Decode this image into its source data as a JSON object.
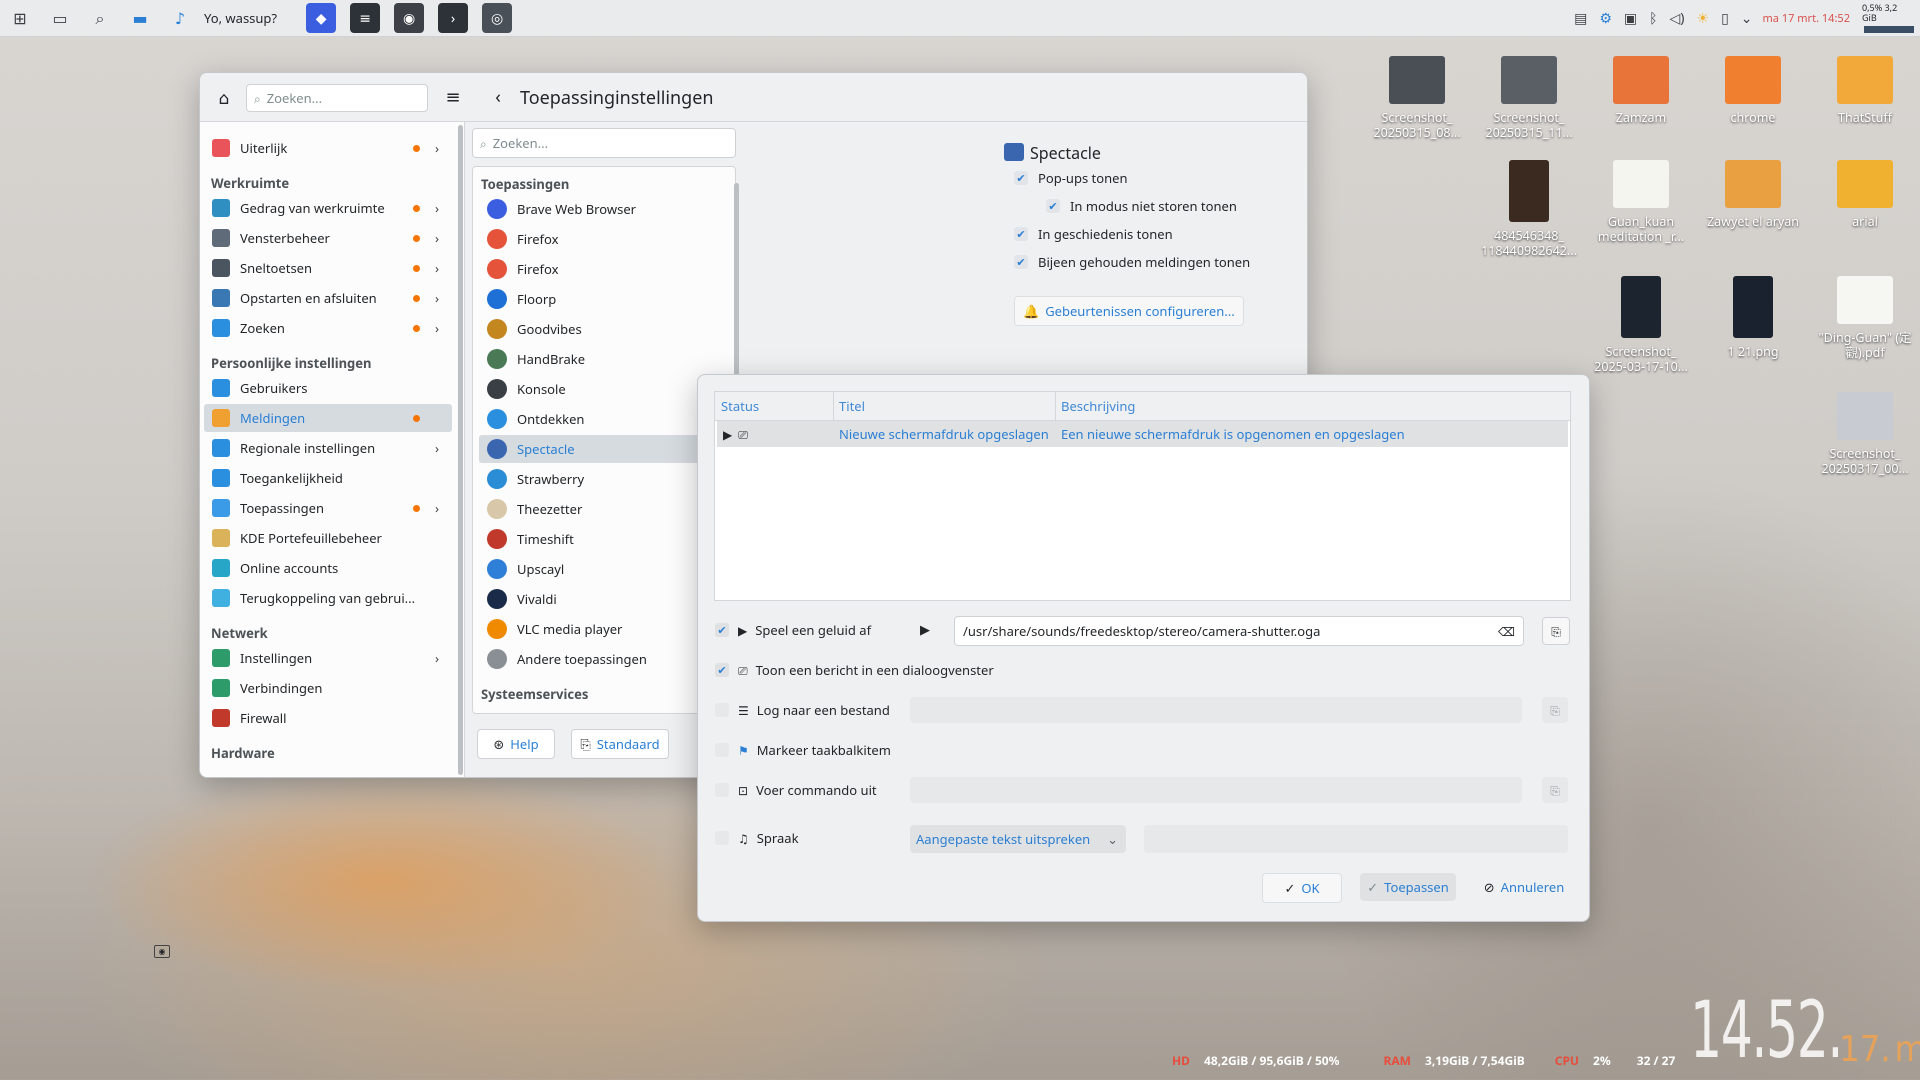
{
  "taskbar": {
    "window_title": "Yo, wassup?",
    "clock": "ma 17 mrt. 14:52",
    "cpu_mini": "0,5%",
    "mem_mini": "3,2 GiB"
  },
  "settings": {
    "search_placeholder": "Zoeken...",
    "page_title": "Toepassinginstellingen",
    "sidebar": [
      {
        "type": "item",
        "label": "Uiterlijk",
        "dot": true,
        "chev": true,
        "color": "#e9535a"
      },
      {
        "type": "section",
        "label": "Werkruimte"
      },
      {
        "type": "item",
        "label": "Gedrag van werkruimte",
        "dot": true,
        "chev": true,
        "color": "#2f8fc1"
      },
      {
        "type": "item",
        "label": "Vensterbeheer",
        "dot": true,
        "chev": true,
        "color": "#5f6b78"
      },
      {
        "type": "item",
        "label": "Sneltoetsen",
        "dot": true,
        "chev": true,
        "color": "#4a5560"
      },
      {
        "type": "item",
        "label": "Opstarten en afsluiten",
        "dot": true,
        "chev": true,
        "color": "#3a78b4"
      },
      {
        "type": "item",
        "label": "Zoeken",
        "dot": true,
        "chev": true,
        "color": "#2b8fe0"
      },
      {
        "type": "section",
        "label": "Persoonlijke instellingen"
      },
      {
        "type": "item",
        "label": "Gebruikers",
        "dot": false,
        "chev": false,
        "color": "#2b8fe0"
      },
      {
        "type": "item",
        "label": "Meldingen",
        "dot": true,
        "chev": false,
        "color": "#f0a030",
        "selected": true
      },
      {
        "type": "item",
        "label": "Regionale instellingen",
        "dot": false,
        "chev": true,
        "color": "#2b8fe0"
      },
      {
        "type": "item",
        "label": "Toegankelijkheid",
        "dot": false,
        "chev": false,
        "color": "#2b8fe0"
      },
      {
        "type": "item",
        "label": "Toepassingen",
        "dot": true,
        "chev": true,
        "color": "#3b9be6"
      },
      {
        "type": "item",
        "label": "KDE Portefeuillebeheer",
        "dot": false,
        "chev": false,
        "color": "#d9b25a"
      },
      {
        "type": "item",
        "label": "Online accounts",
        "dot": false,
        "chev": false,
        "color": "#27a6c8"
      },
      {
        "type": "item",
        "label": "Terugkoppeling van gebrui...",
        "dot": false,
        "chev": false,
        "color": "#3fb0e0"
      },
      {
        "type": "section",
        "label": "Netwerk"
      },
      {
        "type": "item",
        "label": "Instellingen",
        "dot": false,
        "chev": true,
        "color": "#2e9b6a"
      },
      {
        "type": "item",
        "label": "Verbindingen",
        "dot": false,
        "chev": false,
        "color": "#2e9b6a"
      },
      {
        "type": "item",
        "label": "Firewall",
        "dot": false,
        "chev": false,
        "color": "#c0392b"
      },
      {
        "type": "section",
        "label": "Hardware"
      }
    ],
    "apps_search_placeholder": "Zoeken...",
    "apps_section": "Toepassingen",
    "apps": [
      {
        "label": "Brave Web Browser",
        "color": "#3b5ee0"
      },
      {
        "label": "Firefox",
        "color": "#e5533a"
      },
      {
        "label": "Firefox",
        "color": "#e5533a"
      },
      {
        "label": "Floorp",
        "color": "#1e6fd6"
      },
      {
        "label": "Goodvibes",
        "color": "#c4861f"
      },
      {
        "label": "HandBrake",
        "color": "#4a7a55"
      },
      {
        "label": "Konsole",
        "color": "#3a3f45"
      },
      {
        "label": "Ontdekken",
        "color": "#2b8fe0"
      },
      {
        "label": "Spectacle",
        "color": "#3a66b0",
        "selected": true
      },
      {
        "label": "Strawberry",
        "color": "#2a8dd6"
      },
      {
        "label": "Theezetter",
        "color": "#d8c7a8"
      },
      {
        "label": "Timeshift",
        "color": "#c0392b"
      },
      {
        "label": "Upscayl",
        "color": "#2f7fd8"
      },
      {
        "label": "Vivaldi",
        "color": "#1a2b4a"
      },
      {
        "label": "VLC media player",
        "color": "#f08a00"
      },
      {
        "label": "Andere toepassingen",
        "color": "#8a8f95"
      }
    ],
    "system_section": "Systeemservices",
    "help_label": "Help",
    "default_label": "Standaard",
    "detail": {
      "app_name": "Spectacle",
      "options": [
        {
          "label": "Pop-ups tonen",
          "checked": true,
          "indent": false
        },
        {
          "label": "In modus niet storen tonen",
          "checked": true,
          "indent": true
        },
        {
          "label": "In geschiedenis tonen",
          "checked": true,
          "indent": false
        },
        {
          "label": "Bijeen gehouden meldingen tonen",
          "checked": true,
          "indent": false
        }
      ],
      "configure_events": "Gebeurtenissen configureren..."
    }
  },
  "events_dialog": {
    "columns": [
      "Status",
      "Titel",
      "Beschrijving"
    ],
    "rows": [
      {
        "title": "Nieuwe schermafdruk opgeslagen",
        "description": "Een nieuwe schermafdruk is opgenomen en opgeslagen"
      }
    ],
    "actions": {
      "play_sound": {
        "label": "Speel een geluid af",
        "checked": true,
        "path": "/usr/share/sounds/freedesktop/stereo/camera-shutter.oga"
      },
      "show_message": {
        "label": "Toon een bericht in een dialoogvenster",
        "checked": true
      },
      "log_file": {
        "label": "Log naar een bestand",
        "checked": false
      },
      "mark_taskbar": {
        "label": "Markeer taakbalkitem",
        "checked": false
      },
      "run_command": {
        "label": "Voer commando uit",
        "checked": false
      },
      "speech": {
        "label": "Spraak",
        "checked": false,
        "select_value": "Aangepaste tekst uitspreken"
      }
    },
    "ok": "OK",
    "apply": "Toepassen",
    "cancel": "Annuleren"
  },
  "desktop_icons": [
    {
      "label": "Screenshot_ 20250315_08...",
      "color": "#4a4f55"
    },
    {
      "label": "Screenshot_ 20250315_11...",
      "color": "#5a5f66"
    },
    {
      "label": "Zamzam",
      "color": "#e8743a"
    },
    {
      "label": "chrome",
      "color": "#f08030"
    },
    {
      "label": "ThatStuff",
      "color": "#f2a93a"
    },
    {
      "label": "484546348_ 118440982642...",
      "color": "#3a2a20"
    },
    {
      "label": "Guan_kuan meditation _r...",
      "color": "#f5f5f0"
    },
    {
      "label": "Zawyet el aryan",
      "color": "#e8a040"
    },
    {
      "label": "arial",
      "color": "#f0b030"
    },
    {
      "label": "Screenshot_ 2025-03-17-10...",
      "color": "#1c2430"
    },
    {
      "label": "1 21.png",
      "color": "#1a2230"
    },
    {
      "label": "\"Ding-Guan\" (定觀).pdf",
      "color": "#f6f6f2"
    },
    {
      "label": "Screenshot_ 20250317_00...",
      "color": "#c8ccd2"
    }
  ],
  "stats": {
    "hd_label": "HD",
    "hd_value": "48,2GiB / 95,6GiB / 50%",
    "ram_label": "RAM",
    "ram_value": "3,19GiB / 7,54GiB",
    "cpu_label": "CPU",
    "cpu_value": "2%",
    "temp_value": "32 / 27",
    "big_clock": "14.52.",
    "big_clock_day": "17.",
    "big_clock_weekday": "ma"
  }
}
